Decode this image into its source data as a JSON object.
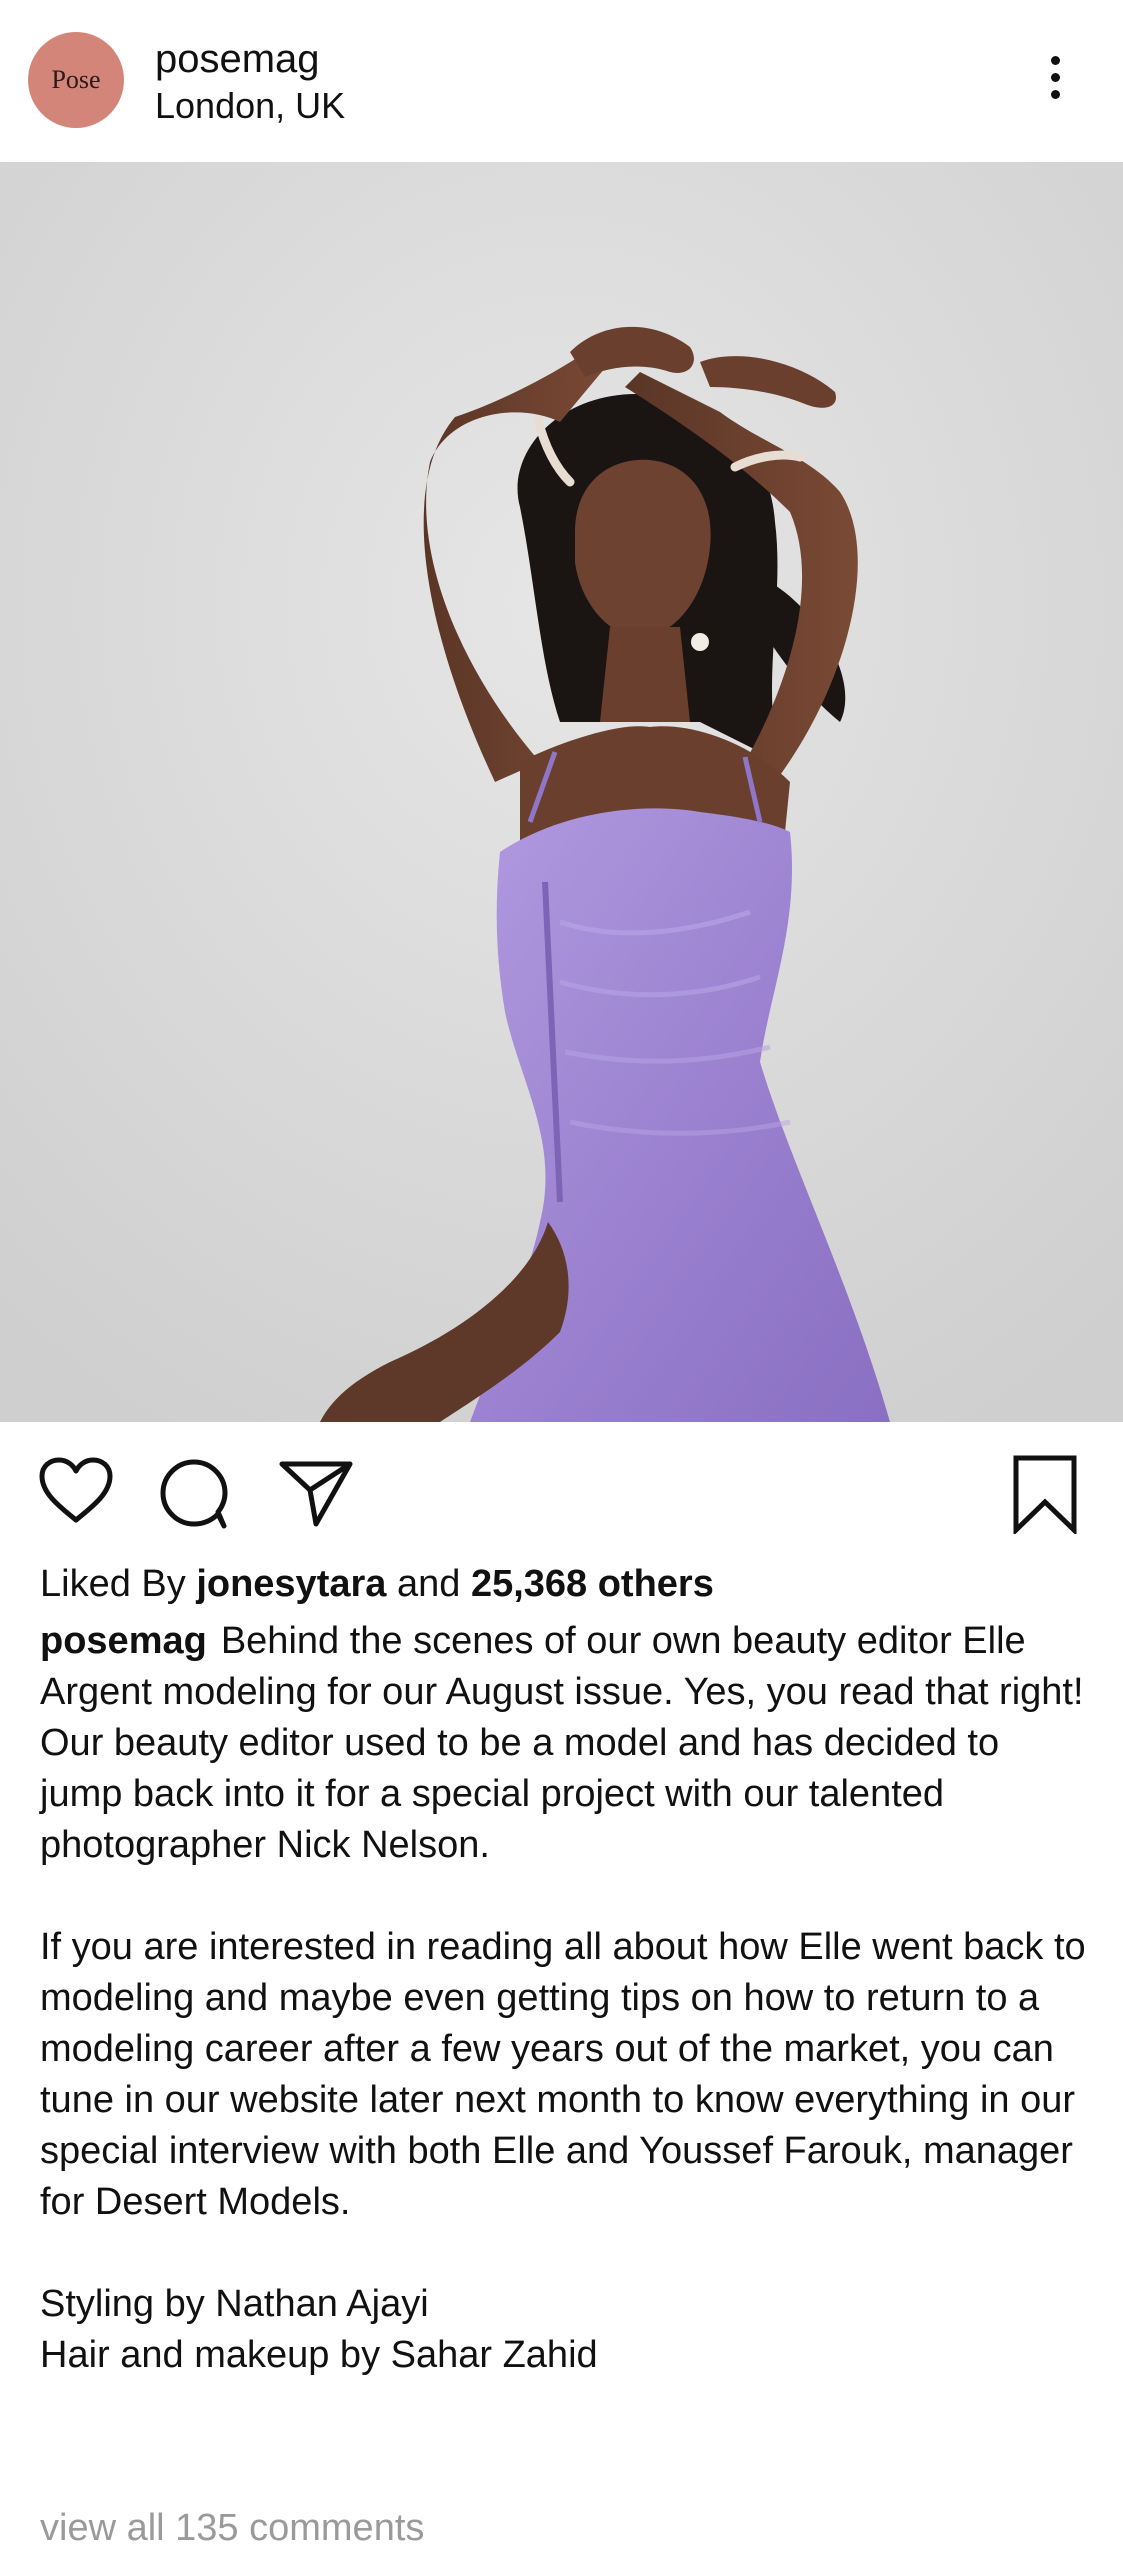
{
  "post": {
    "username": "posemag",
    "location": "London, UK",
    "avatar_text": "Pose"
  },
  "icons": {
    "more": "more-vertical-icon",
    "like": "heart-icon",
    "comment": "comment-bubble-icon",
    "share": "send-paper-plane-icon",
    "save": "bookmark-icon"
  },
  "likes": {
    "prefix": "Liked By",
    "user": "jonesytara",
    "conjunction": "and",
    "others": "25,368 others"
  },
  "caption": {
    "username": "posemag",
    "paragraph1": "Behind the scenes of our own beauty editor Elle Argent modeling for our August issue. Yes, you read that right! Our beauty editor used to be a model and has decided to jump back into it for a special project with our talented photographer Nick Nelson.",
    "paragraph2": "If you are interested in reading all about how Elle went back to modeling and maybe even getting tips on how to return to a modeling career after a few years out of the market, you can tune in our website later next month to know everything in our special interview with both Elle and Youssef Farouk, manager for Desert Models.",
    "line_styling": "Styling by Nathan Ajayi",
    "line_hair": "Hair and makeup by Sahar Zahid"
  },
  "comments": {
    "view_all": "view all 135 comments"
  },
  "colors": {
    "avatar_bg": "#d4857a",
    "dress": "#9f86d2",
    "backdrop": "#dcdcdc",
    "muted_text": "#9a9a9a"
  }
}
